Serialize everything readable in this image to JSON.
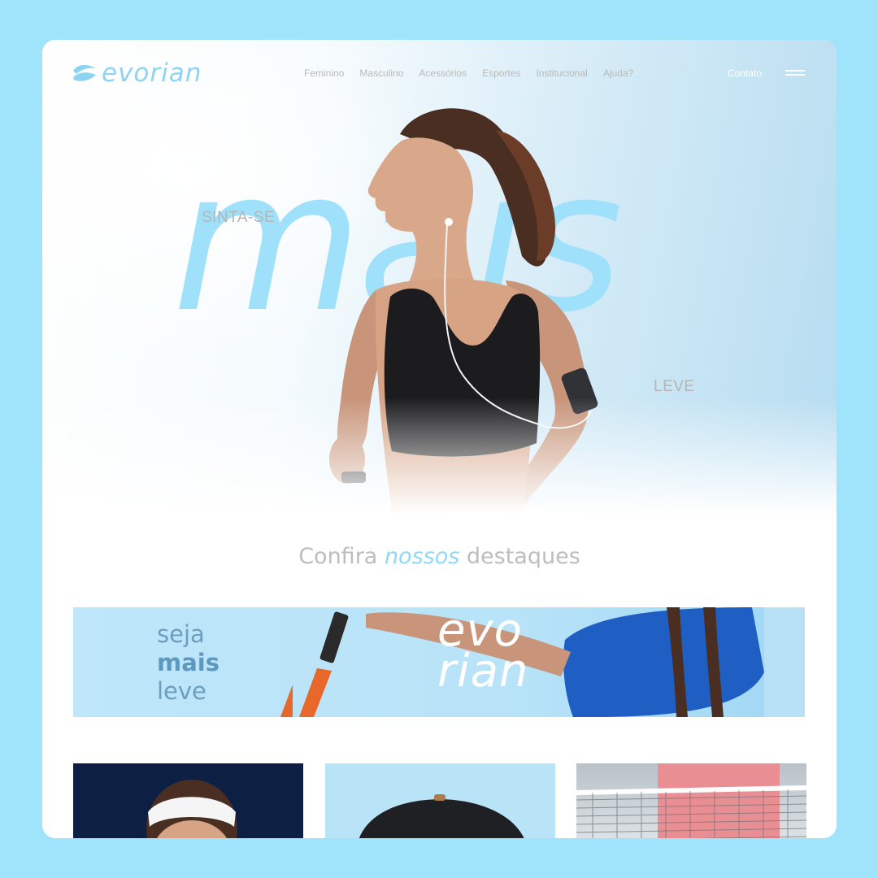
{
  "brand": {
    "name": "evorian",
    "accent_color": "#8fd3f2",
    "icon": "wave-logo-icon"
  },
  "nav": {
    "items": [
      "Feminino",
      "Masculino",
      "Acessórios",
      "Esportes",
      "Institucional",
      "Ajuda?"
    ],
    "contact": "Contato",
    "menu_icon": "hamburger-menu-icon"
  },
  "hero": {
    "top_text": "SINTA-SE",
    "big_word": "mais",
    "bottom_text": "LEVE",
    "big_word_color": "#9fe0fb"
  },
  "highlights": {
    "heading_before": "Confira",
    "heading_accent": "nossos",
    "heading_after": "destaques"
  },
  "banner": {
    "line1": "seja",
    "line2": "mais",
    "line3": "leve",
    "brand_line1": "evo",
    "brand_line2": "rian"
  },
  "cards": [
    {
      "name": "headband-athlete-card",
      "bg": "#0e1f44"
    },
    {
      "name": "cap-product-card",
      "bg": "#b9e4f8"
    },
    {
      "name": "tennis-net-card",
      "bg": "#dfe4e7"
    }
  ]
}
